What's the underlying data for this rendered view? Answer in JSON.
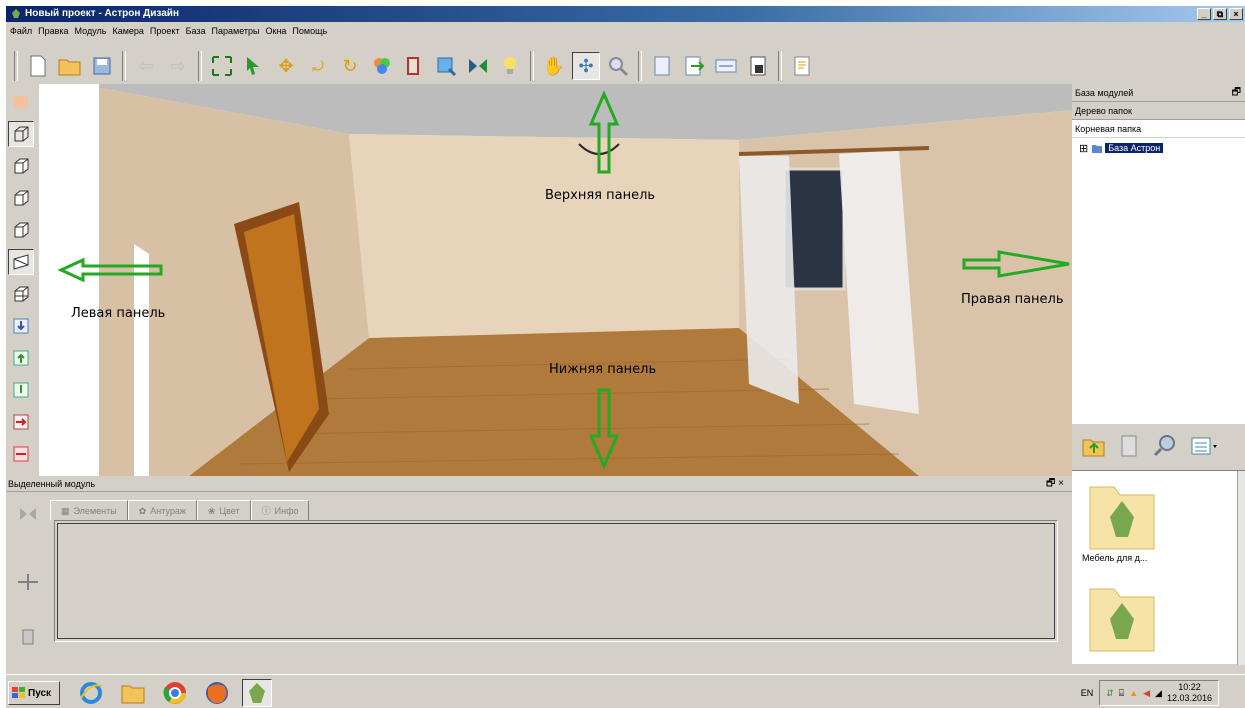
{
  "window": {
    "title": "Новый проект - Астрон Дизайн",
    "controls": [
      "_",
      "⧉",
      "×"
    ]
  },
  "menu": [
    "Файл",
    "Правка",
    "Модуль",
    "Камера",
    "Проект",
    "База",
    "Параметры",
    "Окна",
    "Помощь"
  ],
  "toolbar": {
    "icons": [
      "new-file-icon",
      "open-folder-icon",
      "save-icon",
      "undo-icon",
      "redo-icon",
      "select-icon",
      "pointer-icon",
      "move-icon",
      "rotate-90-icon",
      "rotate-icon",
      "color-palette-icon",
      "door-icon",
      "zoom-icon",
      "mirror-icon",
      "light-bulb-icon",
      "hand-icon",
      "orbit-icon",
      "magnifier-icon",
      "page-icon",
      "export-icon",
      "dimension-icon",
      "print-icon",
      "report-icon"
    ]
  },
  "viewport": {
    "labels": {
      "top": "Верхняя панель",
      "left": "Левая панель",
      "right": "Правая панель",
      "bottom": "Нижняя панель"
    },
    "colors": {
      "wall": "#e7d4bb",
      "ceiling": "#bcbcbc",
      "floor": "#b07a3c",
      "arrow": "#22aa22"
    }
  },
  "right_panel": {
    "header1": "База модулей",
    "header2": "Дерево папок",
    "root_label": "Корневая папка",
    "tree_item": "База Астрон",
    "expand_symbol": "⊞",
    "pin": "🗗",
    "close": "×",
    "files": [
      "Мебель для д..."
    ]
  },
  "bottom_panel": {
    "title": "Выделенный модуль",
    "controls": "🗗 ×",
    "tabs": [
      "Элементы",
      "Антураж",
      "Цвет",
      "Инфо"
    ]
  },
  "taskbar": {
    "start_label": "Пуск",
    "language": "EN",
    "time": "10:22",
    "date": "12.03.2016"
  }
}
